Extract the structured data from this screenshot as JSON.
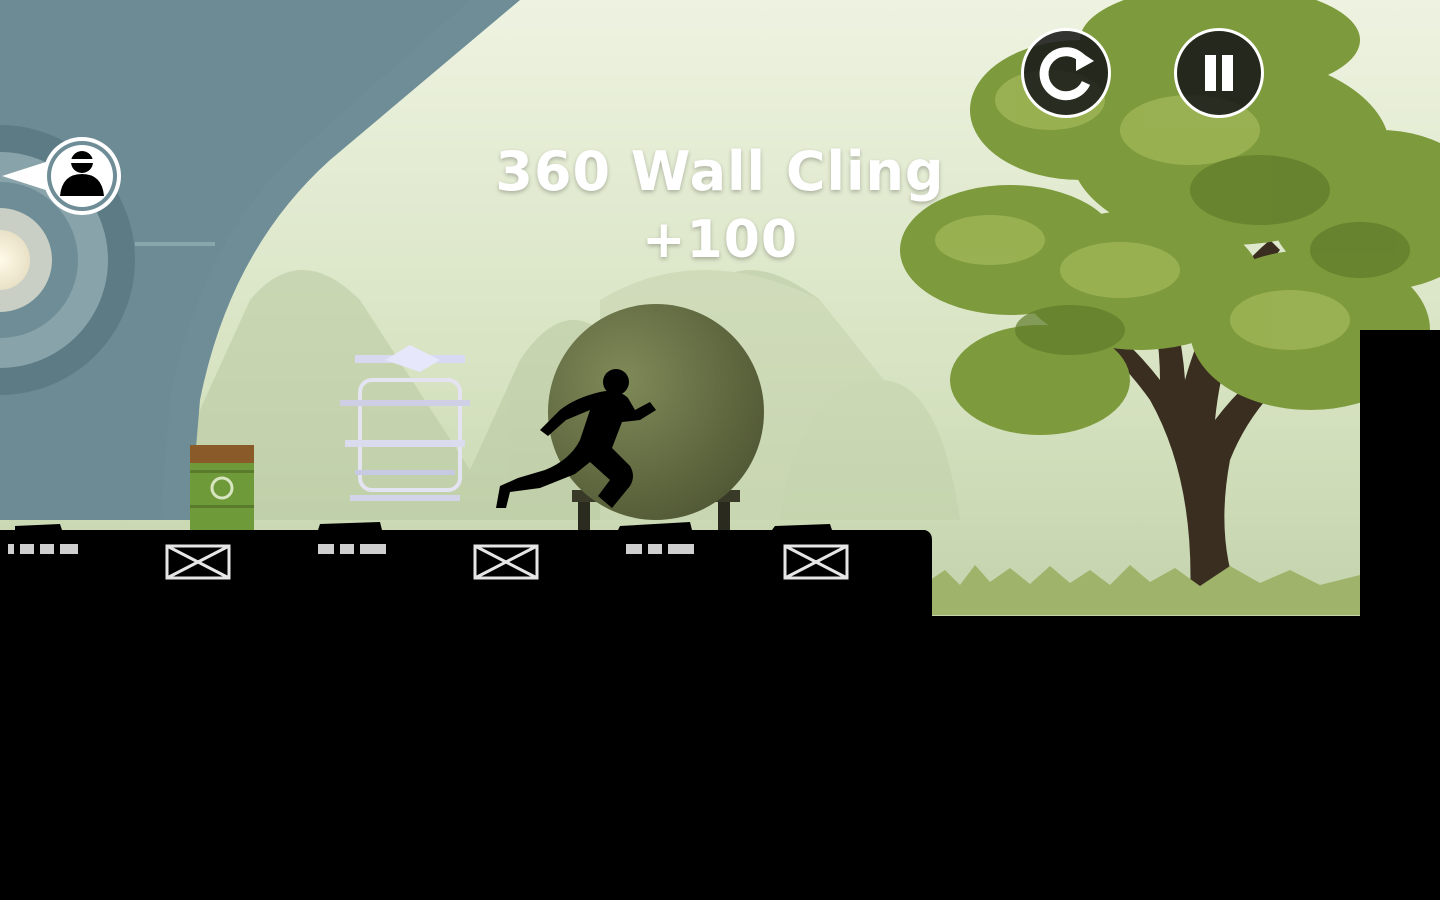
{
  "hud": {
    "restart_icon": "restart-icon",
    "pause_icon": "pause-icon"
  },
  "banner": {
    "trick_name": "360 Wall Cling",
    "trick_points": "+100"
  },
  "chaser": {
    "icon": "hunter-marker-icon"
  },
  "colors": {
    "sky_top": "#e9f1dc",
    "sky_bottom": "#c9dbb6",
    "tree_leaves": "#7e9a3c",
    "hunter_beam": "#6d8c95",
    "barrel": "#6f9a3a",
    "sphere": "#6b7349",
    "silhouette": "#000000",
    "text": "#ffffff"
  }
}
